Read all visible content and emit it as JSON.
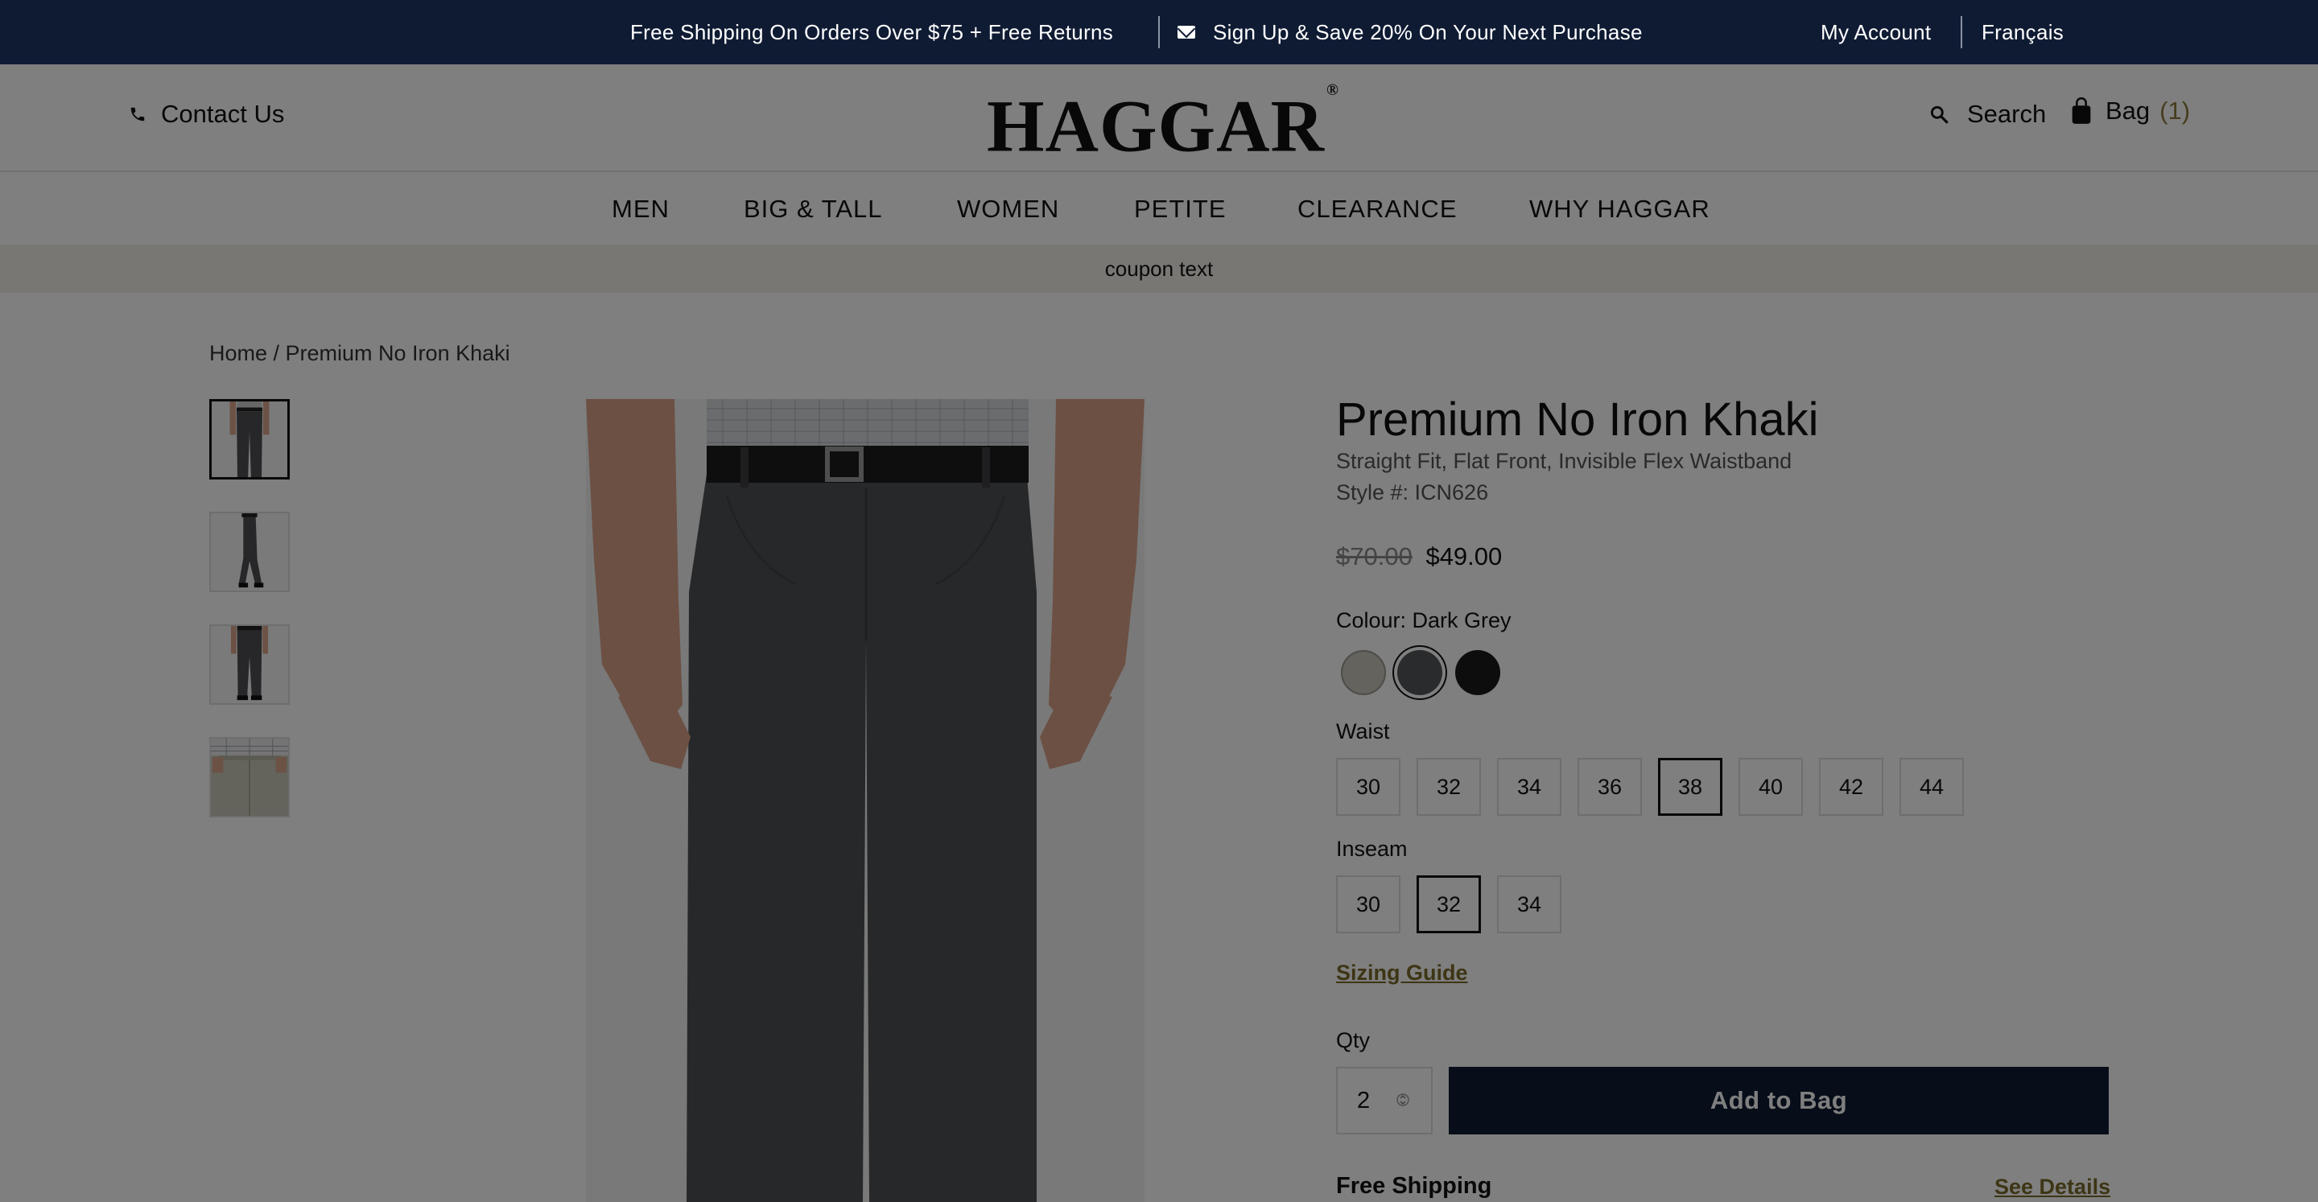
{
  "topbar": {
    "promo_shipping": "Free Shipping On Orders Over $75 + Free Returns",
    "promo_signup": "Sign Up & Save 20% On Your Next Purchase",
    "my_account": "My Account",
    "language": "Français"
  },
  "header": {
    "contact": "Contact Us",
    "logo": "HAGGAR",
    "logo_mark": "®",
    "search": "Search",
    "bag": "Bag",
    "bag_count": "(1)"
  },
  "nav": {
    "items": [
      "MEN",
      "BIG & TALL",
      "WOMEN",
      "PETITE",
      "CLEARANCE",
      "WHY HAGGAR"
    ]
  },
  "coupon": "coupon text",
  "breadcrumb": "Home / Premium No Iron Khaki",
  "product": {
    "title": "Premium No Iron Khaki",
    "subtitle": "Straight Fit, Flat Front, Invisible Flex Waistband",
    "style": "Style #: ICN626",
    "price_old": "$70.00",
    "price_new": "$49.00",
    "colour_label": "Colour: Dark Grey",
    "swatches": [
      {
        "name": "Khaki",
        "color": "#c8c6bb",
        "selected": false
      },
      {
        "name": "Dark Grey",
        "color": "#55565a",
        "selected": true
      },
      {
        "name": "Black",
        "color": "#1a1a1a",
        "selected": false
      }
    ],
    "waist_label": "Waist",
    "waist": [
      "30",
      "32",
      "34",
      "36",
      "38",
      "40",
      "42",
      "44"
    ],
    "waist_selected": "38",
    "inseam_label": "Inseam",
    "inseam": [
      "30",
      "32",
      "34"
    ],
    "inseam_selected": "32",
    "sizing_guide": "Sizing Guide",
    "qty_label": "Qty",
    "qty": "2",
    "add_to_bag": "Add to Bag",
    "free_shipping": "Free Shipping",
    "see_details": "See Details"
  },
  "colors": {
    "navy": "#0f1b33",
    "accent_gold": "#7a6a2a",
    "overlay": "rgba(0,0,0,0.5)"
  }
}
